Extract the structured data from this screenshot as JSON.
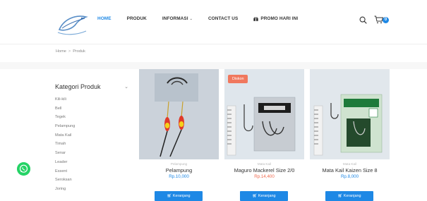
{
  "header": {
    "nav": [
      {
        "label": "HOME"
      },
      {
        "label": "PRODUK"
      },
      {
        "label": "INFORMASI"
      },
      {
        "label": "CONTACT US"
      },
      {
        "label": "PROMO HARI INI"
      }
    ],
    "cart_count": "0",
    "colors": {
      "accent": "#1e88e5"
    }
  },
  "breadcrumb": {
    "home": "Home",
    "separator": ">",
    "current": "Produk"
  },
  "sidebar": {
    "title": "Kategori Produk",
    "categories": [
      "Kili-kili",
      "Bell",
      "Tegek",
      "Pelampung",
      "Mata Kail",
      "Timah",
      "Senar",
      "Leader",
      "Essent",
      "Seroksan",
      "Joring"
    ]
  },
  "products": [
    {
      "category": "Pelampung",
      "name": "Pelampung",
      "price": "Rp.10,000",
      "button": "Keranjang"
    },
    {
      "badge": "Diskon",
      "category": "Mata Kail",
      "name": "Maguro Mackerel Size 2/0",
      "price": "Rp.14,400",
      "button": "Keranjang"
    },
    {
      "category": "Mata Kail",
      "name": "Mata Kail Kaizen Size 8",
      "price": "Rp.8,000",
      "button": "Keranjang"
    }
  ]
}
